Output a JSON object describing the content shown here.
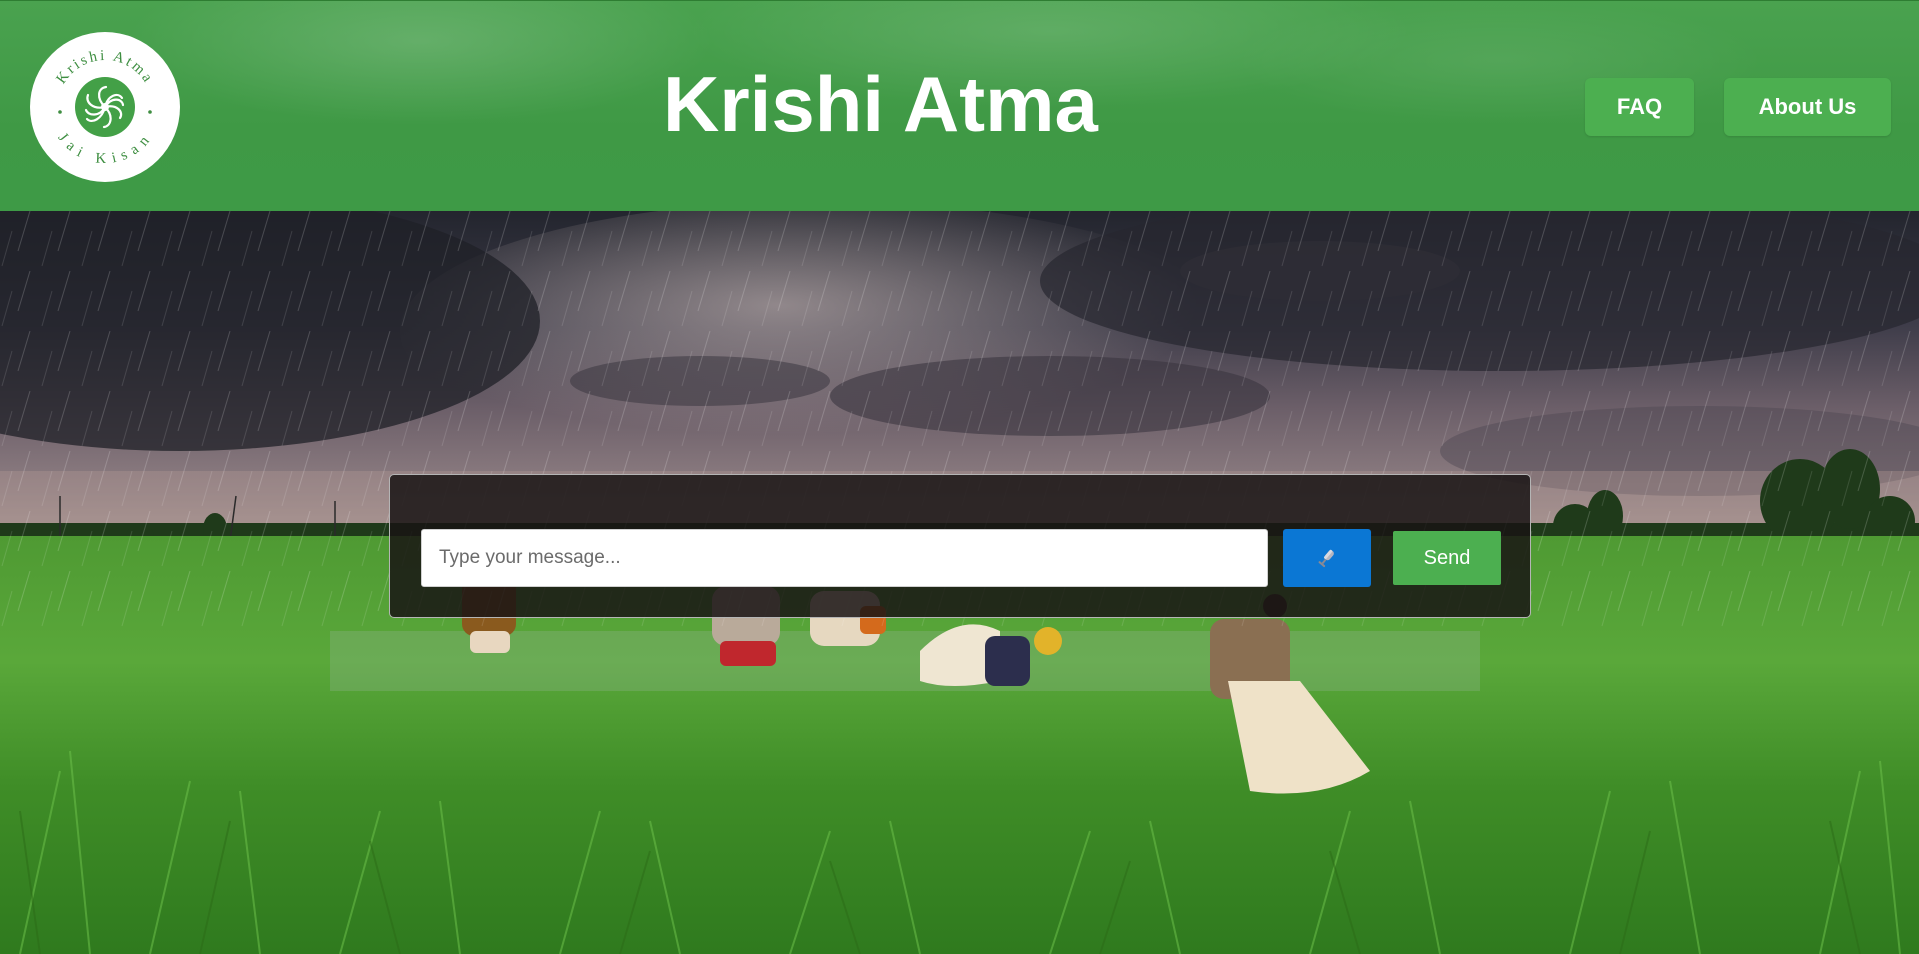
{
  "header": {
    "title": "Krishi Atma",
    "logo": {
      "top_text": "Krishi Atma",
      "bottom_text": "Jai Kisan",
      "icon": "flower-swirl-icon"
    },
    "nav": {
      "faq_label": "FAQ",
      "about_label": "About Us"
    }
  },
  "chat": {
    "placeholder": "Type your message...",
    "mic_icon": "microphone-icon",
    "send_label": "Send"
  },
  "colors": {
    "header_green": "#43a047",
    "button_green": "#4caf50",
    "mic_blue": "#0b77d4",
    "panel_bg": "#1e1818"
  }
}
